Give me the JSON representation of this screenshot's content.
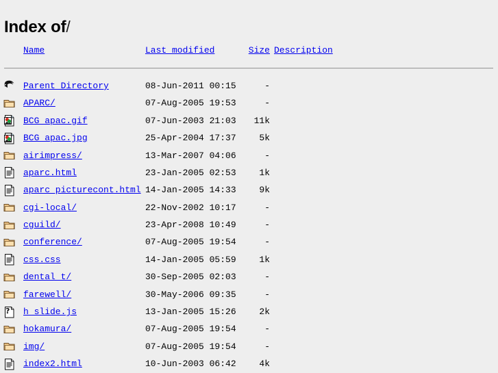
{
  "page": {
    "heading_main": "Index of",
    "heading_path": "/",
    "background_color": "#EEEEEE",
    "link_color": "#0000EE",
    "text_color": "#000000"
  },
  "table": {
    "headers": {
      "icon": "",
      "name": "Name",
      "last_modified": "Last modified",
      "size": "Size",
      "description": "Description"
    },
    "rows": [
      {
        "icon": "back-arrow-icon",
        "name": "Parent Directory",
        "last_modified": "08-Jun-2011 00:15",
        "size": "-",
        "description": ""
      },
      {
        "icon": "folder-icon",
        "name": "APARC/",
        "last_modified": "07-Aug-2005 19:53",
        "size": "-",
        "description": ""
      },
      {
        "icon": "image-file-icon",
        "name": "BCG apac.gif",
        "last_modified": "07-Jun-2003 21:03",
        "size": "11k",
        "description": ""
      },
      {
        "icon": "image-file-icon",
        "name": "BCG apac.jpg",
        "last_modified": "25-Apr-2004 17:37",
        "size": "5k",
        "description": ""
      },
      {
        "icon": "folder-icon",
        "name": "airimpress/",
        "last_modified": "13-Mar-2007 04:06",
        "size": "-",
        "description": ""
      },
      {
        "icon": "text-file-icon",
        "name": "aparc.html",
        "last_modified": "23-Jan-2005 02:53",
        "size": "1k",
        "description": ""
      },
      {
        "icon": "text-file-icon",
        "name": "aparc picturecont.html",
        "last_modified": "14-Jan-2005 14:33",
        "size": "9k",
        "description": ""
      },
      {
        "icon": "folder-icon",
        "name": "cgi-local/",
        "last_modified": "22-Nov-2002 10:17",
        "size": "-",
        "description": ""
      },
      {
        "icon": "folder-icon",
        "name": "cguild/",
        "last_modified": "23-Apr-2008 10:49",
        "size": "-",
        "description": ""
      },
      {
        "icon": "folder-icon",
        "name": "conference/",
        "last_modified": "07-Aug-2005 19:54",
        "size": "-",
        "description": ""
      },
      {
        "icon": "text-file-icon",
        "name": "css.css",
        "last_modified": "14-Jan-2005 05:59",
        "size": "1k",
        "description": ""
      },
      {
        "icon": "folder-icon",
        "name": "dental t/",
        "last_modified": "30-Sep-2005 02:03",
        "size": "-",
        "description": ""
      },
      {
        "icon": "folder-icon",
        "name": "farewell/",
        "last_modified": "30-May-2006 09:35",
        "size": "-",
        "description": ""
      },
      {
        "icon": "unknown-file-icon",
        "name": "h slide.js",
        "last_modified": "13-Jan-2005 15:26",
        "size": "2k",
        "description": ""
      },
      {
        "icon": "folder-icon",
        "name": "hokamura/",
        "last_modified": "07-Aug-2005 19:54",
        "size": "-",
        "description": ""
      },
      {
        "icon": "folder-icon",
        "name": "img/",
        "last_modified": "07-Aug-2005 19:54",
        "size": "-",
        "description": ""
      },
      {
        "icon": "text-file-icon",
        "name": "index2.html",
        "last_modified": "10-Jun-2003 06:42",
        "size": "4k",
        "description": ""
      }
    ]
  }
}
